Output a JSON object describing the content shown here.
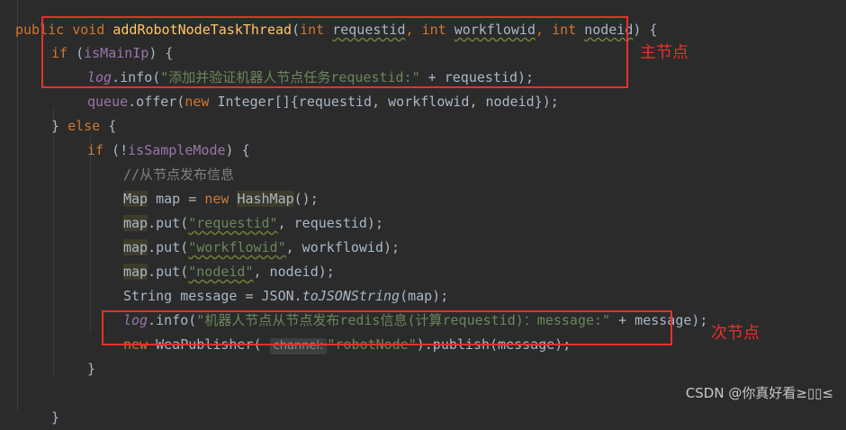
{
  "code": {
    "l1": {
      "kw_public": "public",
      "kw_void": "void",
      "method": "addRobotNodeTaskThread",
      "p1": "(",
      "kw_int1": "int",
      "requestid": "requestid",
      ",": ",",
      "kw_int2": "int",
      "workflowid": "workflowid",
      "comma2": ",",
      "kw_int3": "int",
      "nodeid": "nodeid",
      "end": ") {"
    },
    "l2": {
      "kw_if": "if",
      "open": " (",
      "var": "isMainIp",
      "close": ") {"
    },
    "l3": {
      "log": "log",
      "info": ".info(",
      "str": "\"添加并验证机器人节点任务requestid:\"",
      "tail": " + requestid);"
    },
    "l4": {
      "queue": "queue",
      "offer": ".offer(",
      "kw_new": "new",
      "rest": " Integer[]{requestid, workflowid, nodeid});"
    },
    "l5": {
      "close": "}",
      "kw_else": "else",
      "open": " {"
    },
    "l6": {
      "kw_if": "if",
      "open": " (!",
      "var": "isSampleMode",
      "close": ") {"
    },
    "l7": {
      "comment": "//从节点发布信息"
    },
    "l8": {
      "map_type": "Map",
      "mid": " map = ",
      "kw_new": "new",
      "hashmap": "HashMap",
      "end": "();"
    },
    "l9": {
      "map": "map",
      "put": ".put(",
      "str": "\"requestid\"",
      "tail": ", requestid);"
    },
    "l10": {
      "map": "map",
      "put": ".put(",
      "str": "\"workflowid\"",
      "tail": ", workflowid);"
    },
    "l11": {
      "map": "map",
      "put": ".put(",
      "str": "\"nodeid\"",
      "tail": ", nodeid);"
    },
    "l12": {
      "head": "String message = JSON.",
      "fn": "toJSONString",
      "tail": "(map);"
    },
    "l13": {
      "log": "log",
      "info": ".info(",
      "str": "\"机器人节点从节点发布redis信息(计算requestid)：message:\"",
      "tail": " + message);"
    },
    "l14": {
      "kw_new": "new",
      "mid": " WeaPublisher( ",
      "hint": "channel:",
      "str": "\"robotNode\"",
      "tail": ").publish(message);"
    },
    "l15": {
      "close": "}"
    },
    "l16": {
      "close": "}"
    }
  },
  "annotations": {
    "main_node": "主节点",
    "secondary_node": "次节点"
  },
  "watermark": "CSDN @你真好看≥▯▯≤"
}
